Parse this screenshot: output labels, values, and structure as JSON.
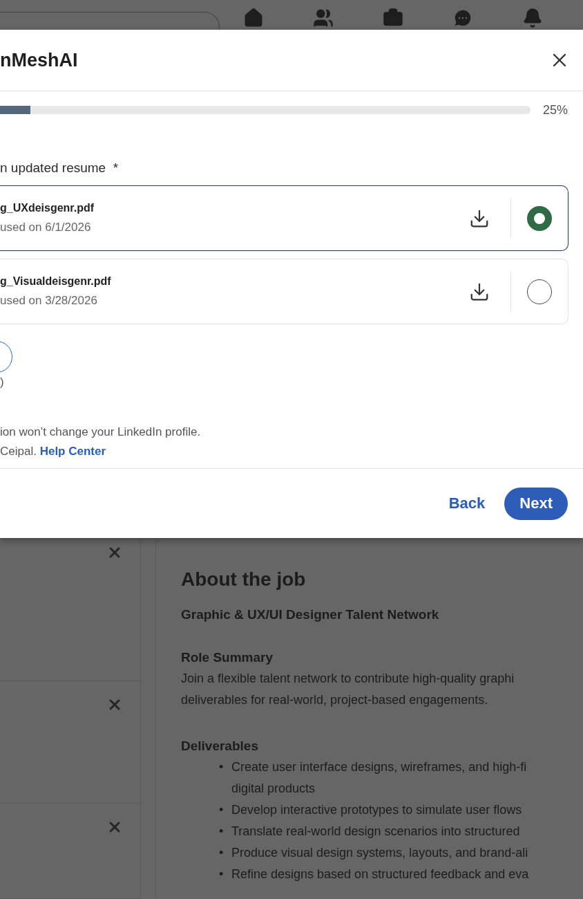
{
  "modal": {
    "title": "nMeshAI",
    "progress": {
      "level": 0.25,
      "reading": "25%"
    },
    "section_label": "n updated resume",
    "required_mark": "*",
    "resumes": [
      {
        "file_name": "g_UXdeisgenr.pdf",
        "last_used": "used on 6/1/2026",
        "selected": true
      },
      {
        "file_name": "g_Visualdeisgenr.pdf",
        "last_used": "used on 3/28/2026",
        "selected": false
      }
    ],
    "note_fragment": ")",
    "disclaimer": "ion won’t change your LinkedIn profile.",
    "policy_text": "Ceipal.",
    "policy_link": "Help Center",
    "back_button": "Back",
    "next_button": "Next"
  },
  "job_description": {
    "heading": "About the job",
    "subtitle": "Graphic & UX/UI Designer Talent Network",
    "sections": [
      {
        "title": "Role Summary",
        "kind": "paragraph",
        "lines": [
          "Join a flexible talent network to contribute high-quality graphi",
          "deliverables for real-world, project-based engagements."
        ]
      },
      {
        "title": "Deliverables",
        "kind": "bullets",
        "marker": "•",
        "lines": [
          "Create user interface designs, wireframes, and high-fi\ndigital products",
          "Develop interactive prototypes to simulate user flows",
          "Translate real-world design scenarios into structured",
          "Produce visual design systems, layouts, and brand-ali",
          "Refine designs based on structured feedback and eva"
        ]
      }
    ]
  }
}
